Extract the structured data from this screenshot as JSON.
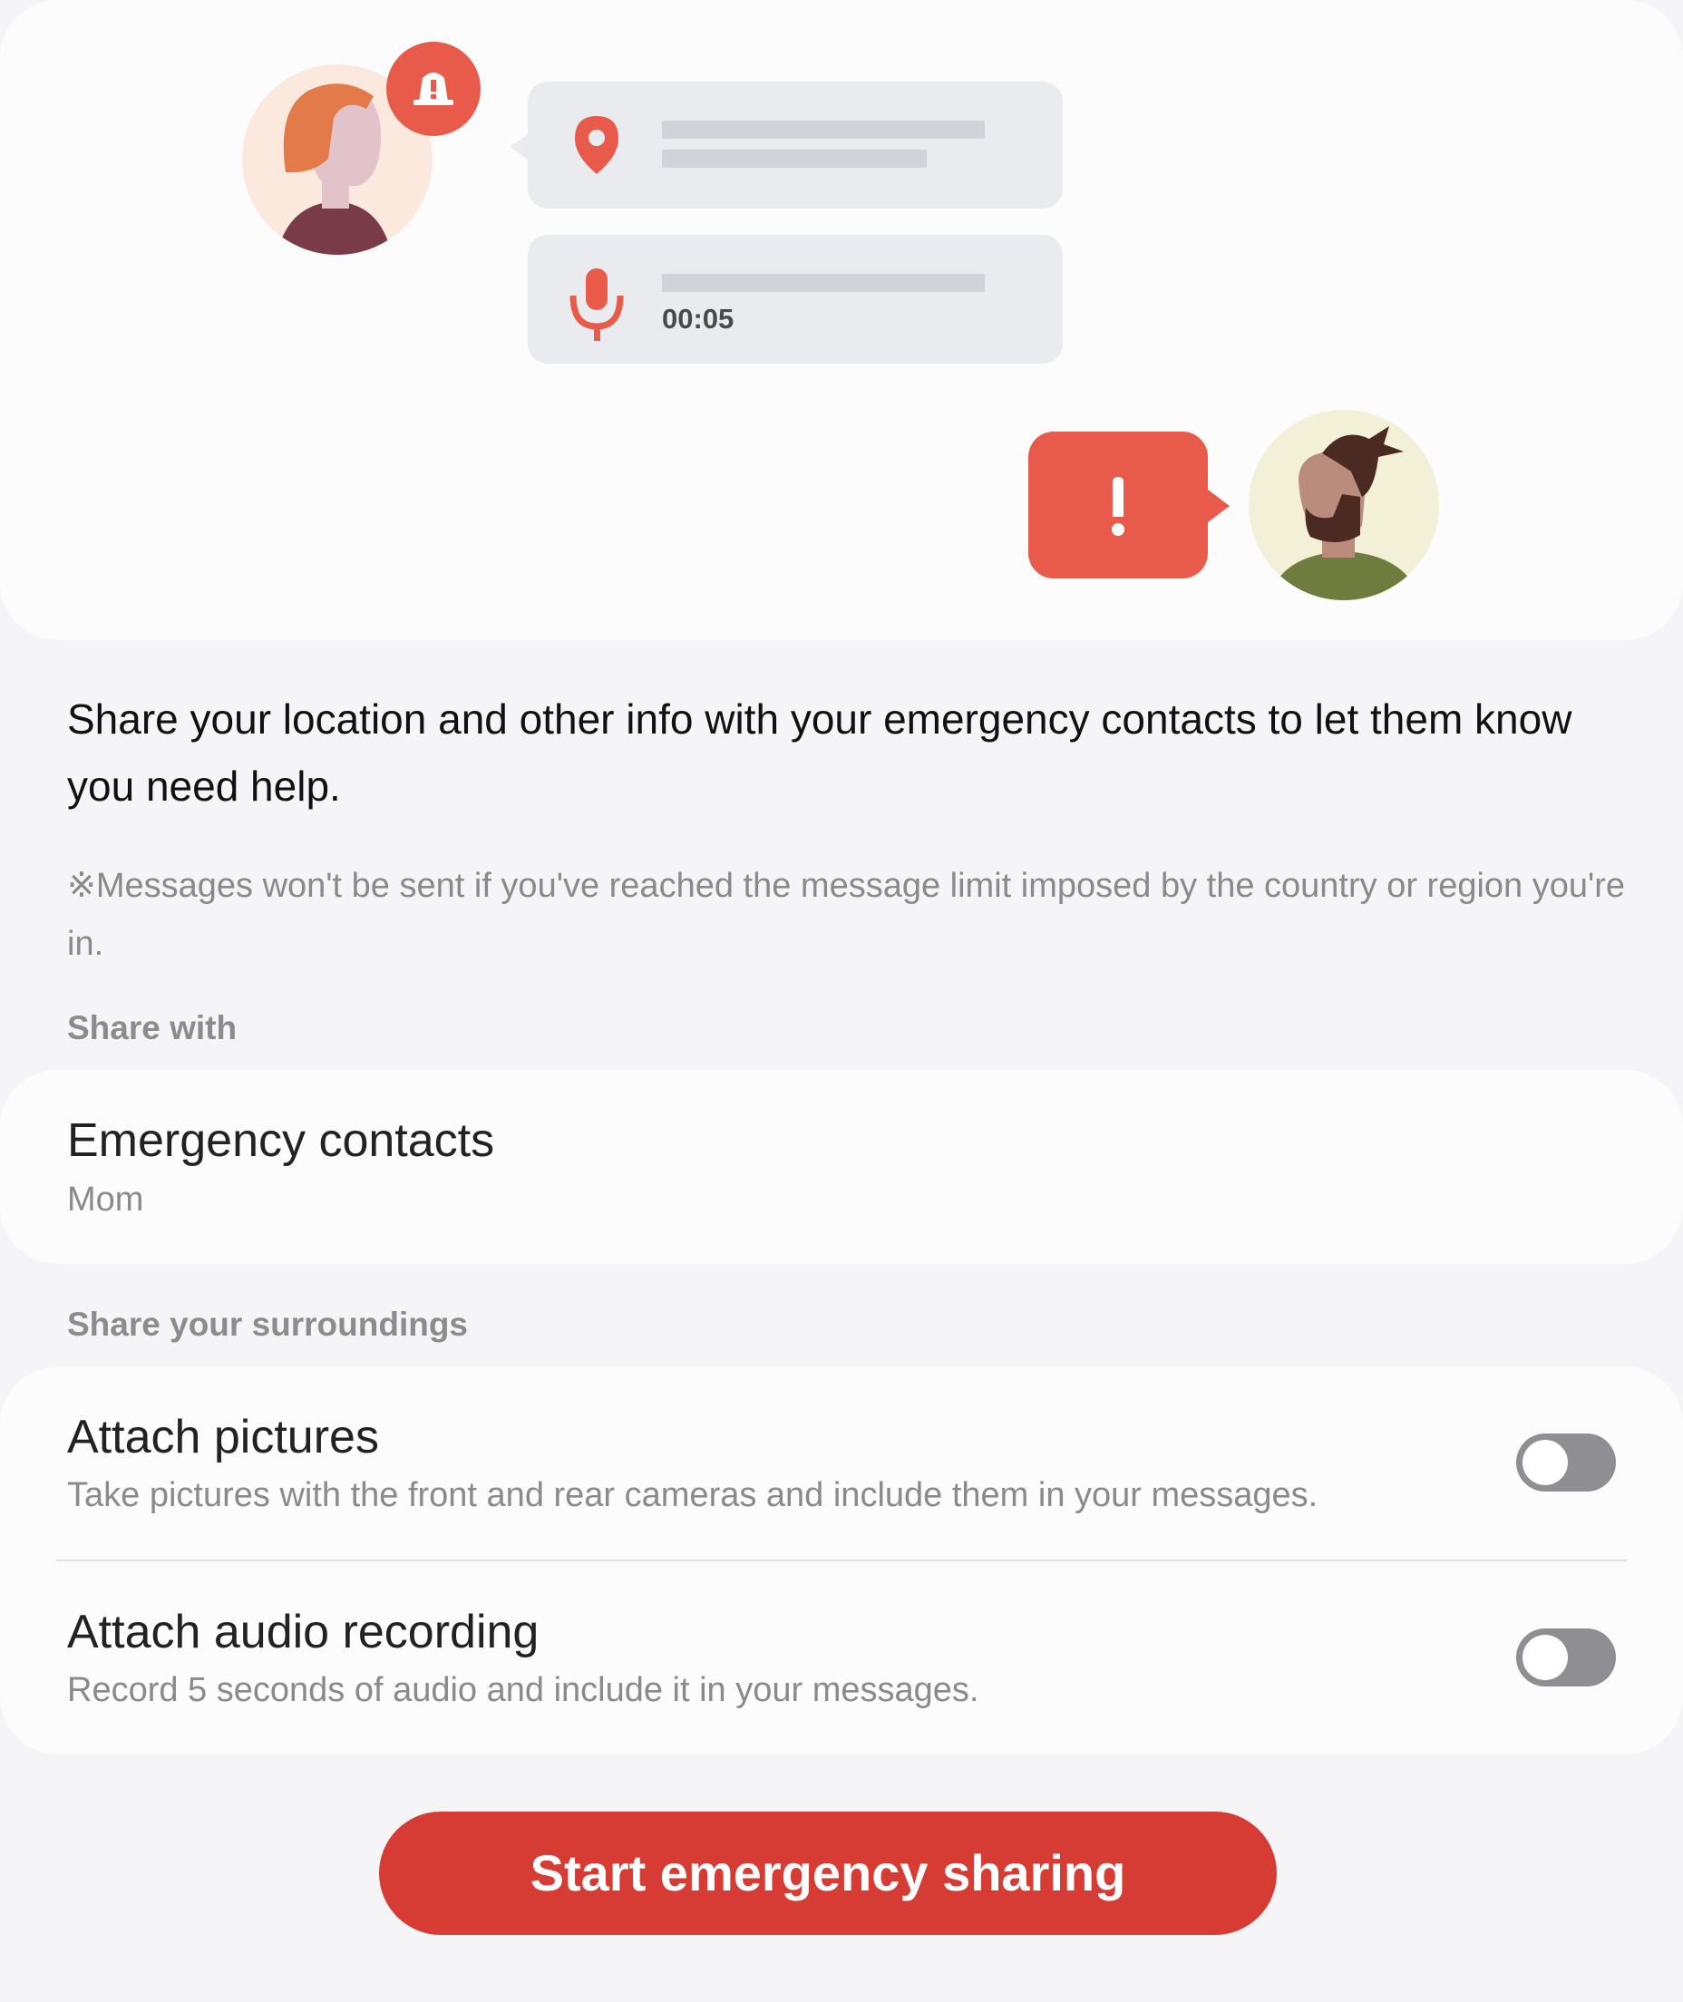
{
  "illustration": {
    "timer": "00:05",
    "alert_symbol": "!",
    "colors": {
      "accent_red": "#e85a4a",
      "bubble_gray": "#e9ebee",
      "line_gray": "#d0d3d9"
    }
  },
  "description": "Share your location and other info with your emergency contacts to let them know you need help.",
  "note": "※Messages won't be sent if you've reached the message limit imposed by the country or region you're in.",
  "share_with": {
    "section_label": "Share with",
    "contacts_title": "Emergency contacts",
    "contacts_value": "Mom"
  },
  "surroundings": {
    "section_label": "Share your surroundings",
    "pictures": {
      "title": "Attach pictures",
      "subtitle": "Take pictures with the front and rear cameras and include them in your messages.",
      "enabled": false
    },
    "audio": {
      "title": "Attach audio recording",
      "subtitle": "Record 5 seconds of audio and include it in your messages.",
      "enabled": false
    }
  },
  "cta_label": "Start emergency sharing"
}
